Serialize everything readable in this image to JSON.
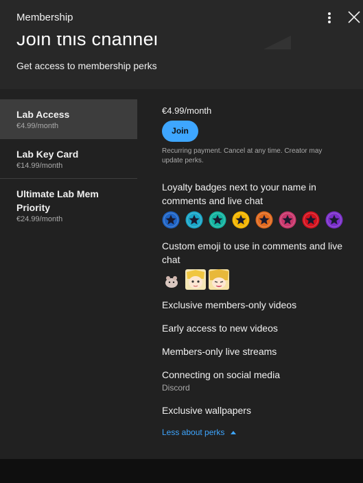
{
  "header": {
    "title": "Membership"
  },
  "hero": {
    "title": "Join this channel",
    "subtitle": "Get access to membership perks"
  },
  "tiers": [
    {
      "name": "Lab Access",
      "price": "€4.99/month",
      "active": true
    },
    {
      "name": "Lab Key Card",
      "price": "€14.99/month",
      "active": false
    },
    {
      "name": "Ultimate Lab Mem Priority",
      "price": "€24.99/month",
      "active": false
    }
  ],
  "detail": {
    "price": "€4.99/month",
    "join_label": "Join",
    "recurring": "Recurring payment. Cancel at any time. Creator may update perks.",
    "perks": {
      "badges_title": "Loyalty badges next to your name in comments and live chat",
      "emoji_title": "Custom emoji to use in comments and live chat",
      "exclusive_videos": "Exclusive members-only videos",
      "early_access": "Early access to new videos",
      "live_streams": "Members-only live streams",
      "social_title": "Connecting on social media",
      "social_sub": "Discord",
      "wallpapers": "Exclusive wallpapers"
    },
    "less_label": "Less about perks"
  },
  "badge_colors": [
    "#1e63c4",
    "#1aa6c8",
    "#14b3a0",
    "#f2b400",
    "#e06a1f",
    "#c8366b",
    "#d3121e",
    "#7a2fc9"
  ],
  "icons": {
    "menu": "kebab-icon",
    "close": "close-icon",
    "star": "star-icon",
    "chevron": "chevron-up-icon"
  }
}
